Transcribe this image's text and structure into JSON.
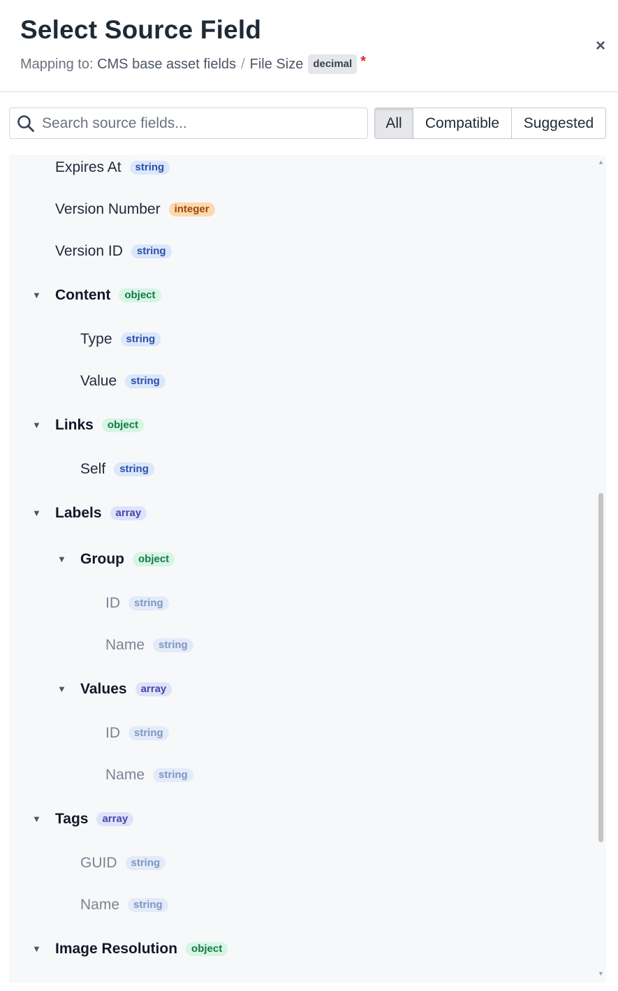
{
  "header": {
    "title": "Select Source Field",
    "mapping_prefix": "Mapping to:",
    "path_root": "CMS base asset fields",
    "path_separator": "/",
    "path_field": "File Size",
    "field_type": "decimal",
    "required_mark": "*",
    "close_icon": "×"
  },
  "search": {
    "placeholder": "Search source fields...",
    "value": ""
  },
  "filters": {
    "options": [
      "All",
      "Compatible",
      "Suggested"
    ],
    "selected": "All"
  },
  "tree": {
    "rows": [
      {
        "label": "Expires At",
        "type": "string"
      },
      {
        "label": "Version Number",
        "type": "integer"
      },
      {
        "label": "Version ID",
        "type": "string"
      },
      {
        "label": "Content",
        "type": "object",
        "expanded": true
      },
      {
        "label": "Type",
        "type": "string"
      },
      {
        "label": "Value",
        "type": "string"
      },
      {
        "label": "Links",
        "type": "object",
        "expanded": true
      },
      {
        "label": "Self",
        "type": "string"
      },
      {
        "label": "Labels",
        "type": "array",
        "expanded": true
      },
      {
        "label": "Group",
        "type": "object",
        "expanded": true
      },
      {
        "label": "ID",
        "type": "string",
        "disabled": true
      },
      {
        "label": "Name",
        "type": "string",
        "disabled": true
      },
      {
        "label": "Values",
        "type": "array",
        "expanded": true
      },
      {
        "label": "ID",
        "type": "string",
        "disabled": true
      },
      {
        "label": "Name",
        "type": "string",
        "disabled": true
      },
      {
        "label": "Tags",
        "type": "array",
        "expanded": true
      },
      {
        "label": "GUID",
        "type": "string",
        "disabled": true
      },
      {
        "label": "Name",
        "type": "string",
        "disabled": true
      },
      {
        "label": "Image Resolution",
        "type": "object",
        "expanded": true
      }
    ]
  },
  "icons": {
    "search": "search-icon",
    "close": "close-icon",
    "expand": "caret-down-icon"
  },
  "colors": {
    "string_badge": "#dbe7fb",
    "integer_badge": "#fdd9ad",
    "object_badge": "#d6f5e2",
    "array_badge": "#dfe2fb",
    "required": "#dc2626"
  }
}
